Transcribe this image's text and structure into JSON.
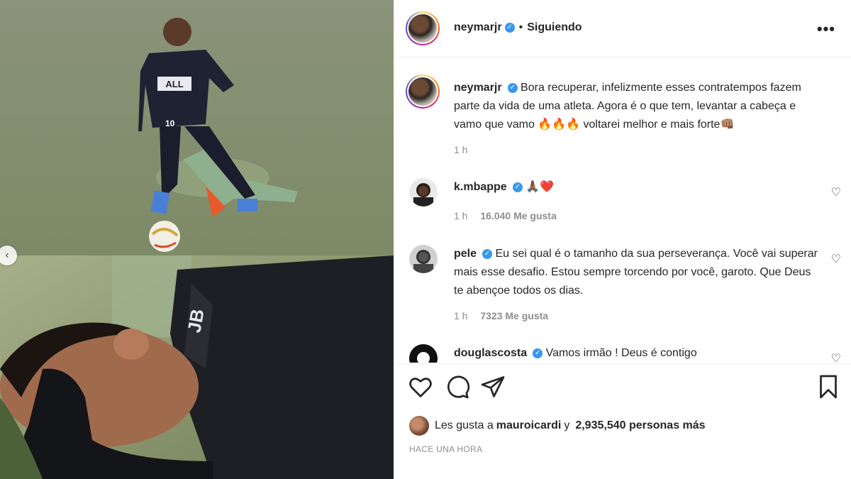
{
  "post": {
    "username": "neymarjr",
    "follow_status": "Siguiendo",
    "more_icon": "more-options-icon",
    "caption_username": "neymarjr",
    "caption_text": "Bora recuperar, infelizmente esses contratempos fazem parte da vida de uma atleta. Agora é o que tem, levantar a cabeça e vamo que vamo 🔥🔥🔥 voltarei melhor e mais forte👊🏽",
    "caption_time": "1 h"
  },
  "photo": {
    "jersey_text": "ALL",
    "number_text": "10"
  },
  "comments": [
    {
      "username": "k.mbappe",
      "text": "🙏🏾❤️",
      "time": "1 h",
      "likes": "16.040 Me gusta"
    },
    {
      "username": "pele",
      "text": "Eu sei qual é o tamanho da sua perseverança. Você vai superar mais esse desafio. Estou sempre torcendo por você, garoto. Que Deus te abençoe todos os dias.",
      "time": "1 h",
      "likes": "7323 Me gusta"
    },
    {
      "username": "douglascosta",
      "text": "Vamos irmão ! Deus é contigo"
    }
  ],
  "likes_line": {
    "prefix": "Les gusta a",
    "user": "mauroicardi",
    "connector": "y",
    "count": "2,935,540 personas más"
  },
  "timestamp": "HACE UNA HORA",
  "colors": {
    "verified": "#3897f0",
    "text": "#262626",
    "muted": "#8e8e8e"
  }
}
